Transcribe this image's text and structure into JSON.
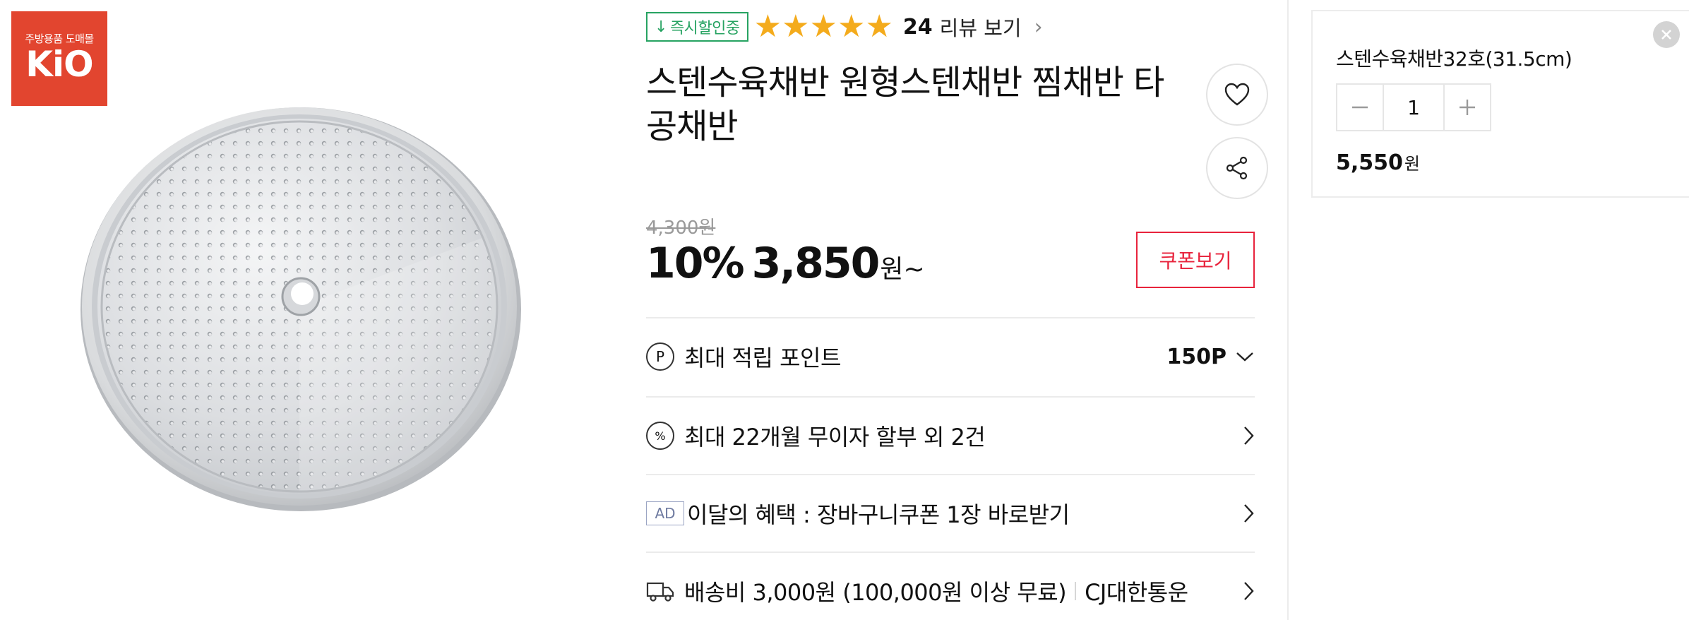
{
  "logo": {
    "subtitle": "주방용품 도매몰",
    "name": "KiO"
  },
  "badge": {
    "arrow": "↓",
    "label": "즉시할인중"
  },
  "rating": {
    "stars": 5,
    "review_count": "24",
    "review_link": "리뷰 보기",
    "chevron": "›"
  },
  "product": {
    "title": "스텐수육채반 원형스텐채반 찜채반 타공채반"
  },
  "price": {
    "original": "4,300원",
    "discount_pct": "10%",
    "sale": "3,850",
    "unit": "원~"
  },
  "coupon": {
    "label": "쿠폰보기"
  },
  "benefits": {
    "points": {
      "icon_glyph": "P",
      "label": "최대 적립 포인트",
      "value": "150P"
    },
    "installment": {
      "icon_glyph": "%",
      "label": "최대 22개월 무이자 할부 외 2건"
    },
    "ad": {
      "badge": "AD",
      "label": "이달의 혜택 : 장바구니쿠폰 1장 바로받기"
    },
    "shipping": {
      "label": "배송비 3,000원 (100,000원 이상 무료)",
      "carrier": "CJ대한통운"
    }
  },
  "option": {
    "name": "스텐수육채반32호(31.5cm)",
    "quantity": "1",
    "price": "5,550",
    "unit": "원"
  },
  "icons": {
    "like": "heart-icon",
    "share": "share-icon",
    "close": "close-icon",
    "minus": "minus-icon",
    "plus": "plus-icon",
    "truck": "truck-icon",
    "star": "star-icon"
  },
  "colors": {
    "brand": "#e2452f",
    "badge_green": "#27a362",
    "star": "#f4ab1c",
    "coupon_red": "#e8233c"
  }
}
